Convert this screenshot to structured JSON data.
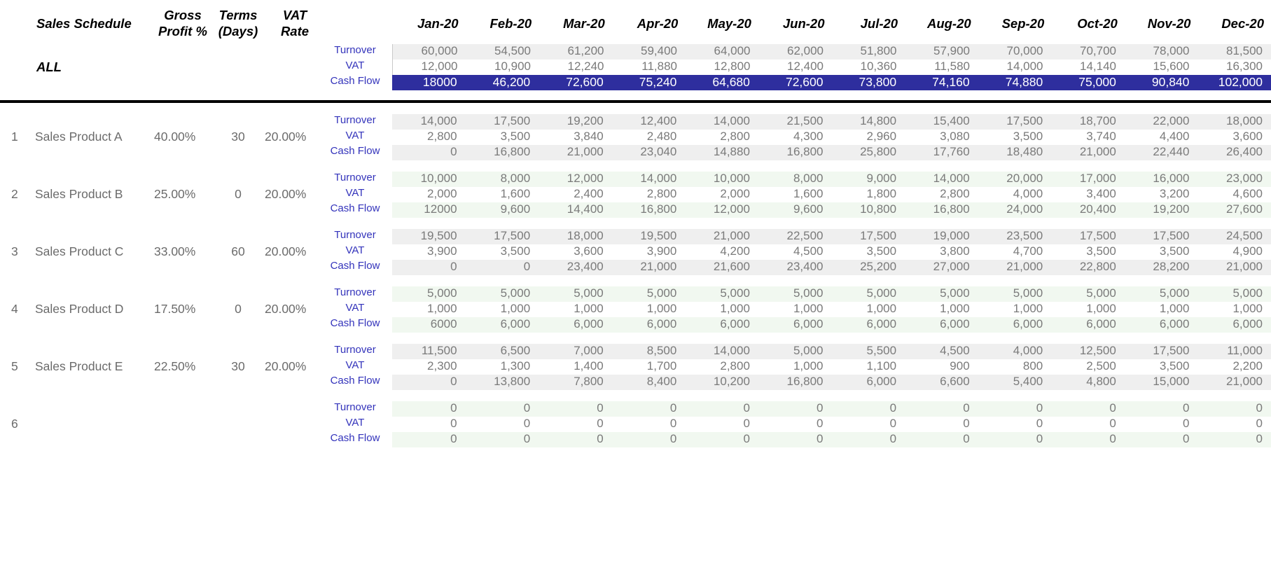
{
  "header": {
    "title_col": "Sales Schedule",
    "gross_profit": "Gross\nProfit %",
    "terms": "Terms\n(Days)",
    "vat_rate": "VAT\nRate",
    "months": [
      "Jan-20",
      "Feb-20",
      "Mar-20",
      "Apr-20",
      "May-20",
      "Jun-20",
      "Jul-20",
      "Aug-20",
      "Sep-20",
      "Oct-20",
      "Nov-20",
      "Dec-20"
    ]
  },
  "metric_labels": {
    "turnover": "Turnover",
    "vat": "VAT",
    "cash_flow": "Cash Flow"
  },
  "colors": {
    "metric_label": "#3333bb",
    "value_text": "#7a7a7a",
    "cash_flow_highlight": "#2e2e9e",
    "band_gray": "#efefef",
    "band_green": "#f1f8f0"
  },
  "summary": {
    "name": "ALL",
    "turnover": [
      "60,000",
      "54,500",
      "61,200",
      "59,400",
      "64,000",
      "62,000",
      "51,800",
      "57,900",
      "70,000",
      "70,700",
      "78,000",
      "81,500"
    ],
    "vat": [
      "12,000",
      "10,900",
      "12,240",
      "11,880",
      "12,800",
      "12,400",
      "10,360",
      "11,580",
      "14,000",
      "14,140",
      "15,600",
      "16,300"
    ],
    "cash_flow": [
      "18000",
      "46,200",
      "72,600",
      "75,240",
      "64,680",
      "72,600",
      "73,800",
      "74,160",
      "74,880",
      "75,000",
      "90,840",
      "102,000"
    ]
  },
  "rows": [
    {
      "index": "1",
      "name": "Sales Product A",
      "gross_profit": "40.00%",
      "terms": "30",
      "vat_rate": "20.00%",
      "tint": "gray",
      "turnover": [
        "14,000",
        "17,500",
        "19,200",
        "12,400",
        "14,000",
        "21,500",
        "14,800",
        "15,400",
        "17,500",
        "18,700",
        "22,000",
        "18,000"
      ],
      "vat": [
        "2,800",
        "3,500",
        "3,840",
        "2,480",
        "2,800",
        "4,300",
        "2,960",
        "3,080",
        "3,500",
        "3,740",
        "4,400",
        "3,600"
      ],
      "cash_flow": [
        "0",
        "16,800",
        "21,000",
        "23,040",
        "14,880",
        "16,800",
        "25,800",
        "17,760",
        "18,480",
        "21,000",
        "22,440",
        "26,400"
      ]
    },
    {
      "index": "2",
      "name": "Sales Product B",
      "gross_profit": "25.00%",
      "terms": "0",
      "vat_rate": "20.00%",
      "tint": "green",
      "turnover": [
        "10,000",
        "8,000",
        "12,000",
        "14,000",
        "10,000",
        "8,000",
        "9,000",
        "14,000",
        "20,000",
        "17,000",
        "16,000",
        "23,000"
      ],
      "vat": [
        "2,000",
        "1,600",
        "2,400",
        "2,800",
        "2,000",
        "1,600",
        "1,800",
        "2,800",
        "4,000",
        "3,400",
        "3,200",
        "4,600"
      ],
      "cash_flow": [
        "12000",
        "9,600",
        "14,400",
        "16,800",
        "12,000",
        "9,600",
        "10,800",
        "16,800",
        "24,000",
        "20,400",
        "19,200",
        "27,600"
      ]
    },
    {
      "index": "3",
      "name": "Sales Product C",
      "gross_profit": "33.00%",
      "terms": "60",
      "vat_rate": "20.00%",
      "tint": "gray",
      "turnover": [
        "19,500",
        "17,500",
        "18,000",
        "19,500",
        "21,000",
        "22,500",
        "17,500",
        "19,000",
        "23,500",
        "17,500",
        "17,500",
        "24,500"
      ],
      "vat": [
        "3,900",
        "3,500",
        "3,600",
        "3,900",
        "4,200",
        "4,500",
        "3,500",
        "3,800",
        "4,700",
        "3,500",
        "3,500",
        "4,900"
      ],
      "cash_flow": [
        "0",
        "0",
        "23,400",
        "21,000",
        "21,600",
        "23,400",
        "25,200",
        "27,000",
        "21,000",
        "22,800",
        "28,200",
        "21,000"
      ]
    },
    {
      "index": "4",
      "name": "Sales Product D",
      "gross_profit": "17.50%",
      "terms": "0",
      "vat_rate": "20.00%",
      "tint": "green",
      "turnover": [
        "5,000",
        "5,000",
        "5,000",
        "5,000",
        "5,000",
        "5,000",
        "5,000",
        "5,000",
        "5,000",
        "5,000",
        "5,000",
        "5,000"
      ],
      "vat": [
        "1,000",
        "1,000",
        "1,000",
        "1,000",
        "1,000",
        "1,000",
        "1,000",
        "1,000",
        "1,000",
        "1,000",
        "1,000",
        "1,000"
      ],
      "cash_flow": [
        "6000",
        "6,000",
        "6,000",
        "6,000",
        "6,000",
        "6,000",
        "6,000",
        "6,000",
        "6,000",
        "6,000",
        "6,000",
        "6,000"
      ]
    },
    {
      "index": "5",
      "name": "Sales Product E",
      "gross_profit": "22.50%",
      "terms": "30",
      "vat_rate": "20.00%",
      "tint": "gray",
      "turnover": [
        "11,500",
        "6,500",
        "7,000",
        "8,500",
        "14,000",
        "5,000",
        "5,500",
        "4,500",
        "4,000",
        "12,500",
        "17,500",
        "11,000"
      ],
      "vat": [
        "2,300",
        "1,300",
        "1,400",
        "1,700",
        "2,800",
        "1,000",
        "1,100",
        "900",
        "800",
        "2,500",
        "3,500",
        "2,200"
      ],
      "cash_flow": [
        "0",
        "13,800",
        "7,800",
        "8,400",
        "10,200",
        "16,800",
        "6,000",
        "6,600",
        "5,400",
        "4,800",
        "15,000",
        "21,000"
      ]
    },
    {
      "index": "6",
      "name": "",
      "gross_profit": "",
      "terms": "",
      "vat_rate": "",
      "tint": "green",
      "turnover": [
        "0",
        "0",
        "0",
        "0",
        "0",
        "0",
        "0",
        "0",
        "0",
        "0",
        "0",
        "0"
      ],
      "vat": [
        "0",
        "0",
        "0",
        "0",
        "0",
        "0",
        "0",
        "0",
        "0",
        "0",
        "0",
        "0"
      ],
      "cash_flow": [
        "0",
        "0",
        "0",
        "0",
        "0",
        "0",
        "0",
        "0",
        "0",
        "0",
        "0",
        "0"
      ]
    }
  ]
}
